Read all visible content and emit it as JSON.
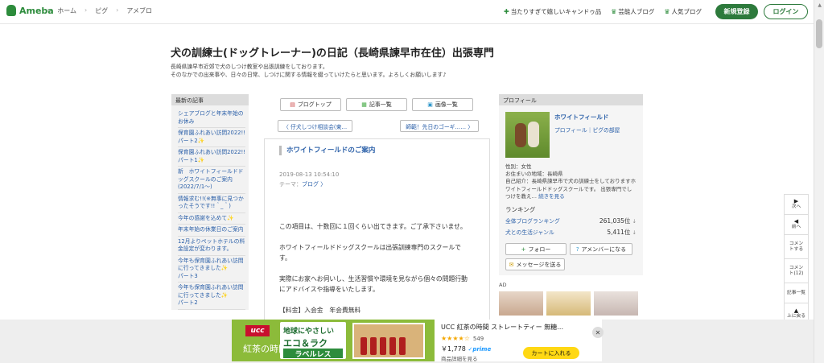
{
  "header": {
    "logo": "Ameba",
    "nav": [
      "ホーム",
      "ピグ",
      "アメブロ"
    ],
    "links": [
      {
        "icon": "plus-icon",
        "label": "当たりすぎて嬉しいキャンドゥ品"
      },
      {
        "icon": "crown-icon",
        "label": "芸能人ブログ"
      },
      {
        "icon": "crown-icon",
        "label": "人気ブログ"
      }
    ],
    "register": "新規登録",
    "login": "ログイン"
  },
  "blog": {
    "title": "犬の訓練士(ドッグトレーナー)の日記（長崎県諫早市在住）出張専門",
    "desc1": "長崎県諫早市近郊で犬のしつけ教室や出張訓練をしております。",
    "desc2": "そのなかでの出来事や、日々の日常、しつけに関する情報を綴っていけたらと思います。よろしくお願いします♪"
  },
  "recent": {
    "heading": "最新の記事",
    "items": [
      {
        "text": "シェアブログと年末年始のお休み",
        "spark": ""
      },
      {
        "text": "保育園ふれあい訪問2022!!パート2",
        "spark": "✨"
      },
      {
        "text": "保育園ふれあい訪問2022!!パート1",
        "spark": "✨"
      },
      {
        "text": "新　ホワイトフィールドドッグスクールのご案内(2022/7/1〜)",
        "spark": ""
      },
      {
        "text": "情報求む!!(※無事に見つかったそうです!!＾_＾)",
        "spark": ""
      },
      {
        "text": "今年の感謝を込めて",
        "spark": "✨"
      },
      {
        "text": "年末年始の休業日のご案内",
        "spark": ""
      },
      {
        "text": "12月よりペットホテルの料金設定が変わります。",
        "spark": ""
      },
      {
        "text": "今年も保育園ふれあい訪問に行ってきました",
        "spark": "✨"
      },
      {
        "text": "パート3",
        "spark": ""
      },
      {
        "text": "今年も保育園ふれあい訪問に行ってきました",
        "spark": "✨"
      },
      {
        "text": "パート2",
        "spark": ""
      }
    ]
  },
  "tabs": [
    {
      "icon": "document-icon",
      "label": "ブログトップ"
    },
    {
      "icon": "list-icon",
      "label": "記事一覧"
    },
    {
      "icon": "image-icon",
      "label": "画像一覧"
    }
  ],
  "pager": {
    "prev": "〈 仔犬しつけ相談会(東…",
    "next": "師範！先日のゴーギ…… 〉"
  },
  "article": {
    "title": "ホワイトフィールドのご案内",
    "date": "2019-08-13 10:54:10",
    "theme_label": "テーマ：",
    "theme": "ブログ 〉",
    "p1": "この項目は、十数回に１回くらい出てきます。ご了承下さいませ。",
    "p2": "ホワイトフィールドドッグスクールは出張訓練専門のスクールです。",
    "p3": "実際にお家へお伺いし、生活習慣や環境を見ながら個々の問題行動にアドバイスや指導をいたします。",
    "p4": "【料金】入会金　年会費無料"
  },
  "profile": {
    "heading": "プロフィール",
    "name": "ホワイトフィールド",
    "sub": "プロフィール｜ピグの部屋",
    "gender": "性別：女性",
    "area": "お住まいの地域：長崎県",
    "intro": "自己紹介：長崎県諫早市で犬の訓練士をしておりますホワイトフィールドドッグスクールです。 出張専門でしつけを教え…",
    "more": "続きを見る",
    "ranking_head": "ランキング",
    "rankings": [
      {
        "label": "全体ブログランキング",
        "value": "261,035位",
        "arrow": "↓"
      },
      {
        "label": "犬との生活ジャンル",
        "value": "5,411位",
        "arrow": "↓"
      }
    ],
    "follow": "フォロー",
    "ameba_member": "アメンバーになる",
    "message": "メッセージを送る",
    "ad_label": "AD"
  },
  "side_nav": [
    {
      "arrow": "▶",
      "label": "次へ"
    },
    {
      "arrow": "◀",
      "label": "前へ"
    },
    {
      "arrow": "",
      "label": "コメントする"
    },
    {
      "arrow": "",
      "label": "コメント(12)"
    },
    {
      "arrow": "",
      "label": "記事一覧"
    },
    {
      "arrow": "▲",
      "label": "上に戻る"
    }
  ],
  "bottom_ad": {
    "brand": "ucc",
    "brand_sub": "紅茶の時間",
    "copy1": "地球にやさしい",
    "copy2": "エコ＆ラク",
    "copy3": "ラベルレス",
    "product": "UCC 紅茶の時間 ストレートティー 無糖…",
    "stars": "★★★★☆",
    "reviews": "549",
    "price": "￥1,778",
    "prime": "✓prime",
    "detail": "商品詳細を見る",
    "cart": "カートに入れる",
    "close": "✕"
  }
}
